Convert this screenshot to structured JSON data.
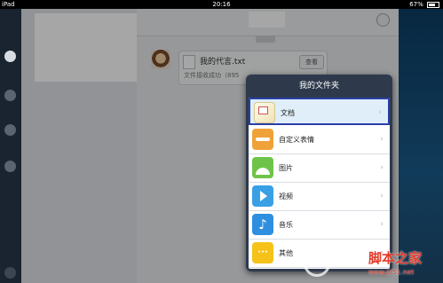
{
  "status_bar": {
    "device": "iPad",
    "time": "20:16",
    "battery": "67%"
  },
  "chat": {
    "timestamp": "· · ·",
    "message": {
      "file_name": "我的代言.txt",
      "status_text": "文件接收成功（895",
      "view_button": "查看"
    }
  },
  "popover": {
    "title": "我的文件夹",
    "items": [
      {
        "label": "文档",
        "icon": "documents-icon",
        "selected": true
      },
      {
        "label": "自定义表情",
        "icon": "custom-emoji-icon",
        "selected": false
      },
      {
        "label": "图片",
        "icon": "pictures-icon",
        "selected": false
      },
      {
        "label": "视频",
        "icon": "video-icon",
        "selected": false
      },
      {
        "label": "音乐",
        "icon": "music-icon",
        "selected": false
      },
      {
        "label": "其他",
        "icon": "other-icon",
        "selected": false
      }
    ],
    "chevron": "›",
    "music_glyph": "♪",
    "other_glyph": "···"
  },
  "watermark": {
    "text": "脚本之家",
    "url": "www.jb51.net"
  },
  "colors": {
    "selection_border": "#2a3ea8",
    "popover_bg": "#2e3a4c"
  }
}
